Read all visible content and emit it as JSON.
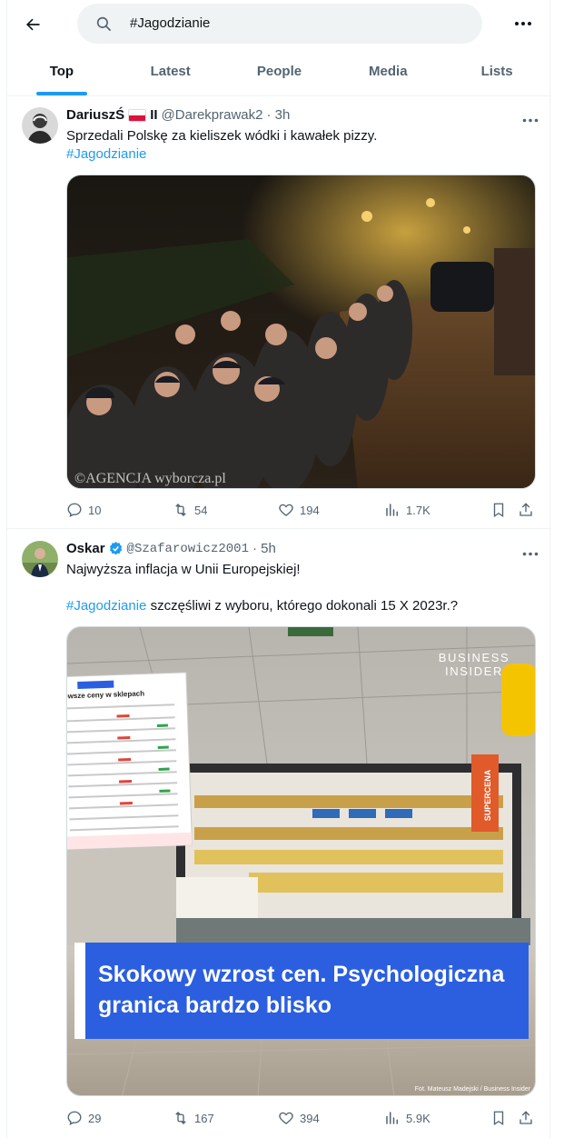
{
  "search": {
    "query": "#Jagodzianie"
  },
  "tabs": [
    {
      "label": "Top"
    },
    {
      "label": "Latest"
    },
    {
      "label": "People"
    },
    {
      "label": "Media"
    },
    {
      "label": "Lists"
    }
  ],
  "tweets": [
    {
      "name": "DariuszŚ",
      "name_suffix": "II",
      "handle": "@Darekprawak2",
      "time": "· 3h",
      "text": "Sprzedali Polskę za kieliszek wódki i kawałek pizzy.",
      "hashtag": "#Jagodzianie",
      "image_watermark": "©AGENCJA wyborcza.pl",
      "stats": {
        "replies": "10",
        "retweets": "54",
        "likes": "194",
        "views": "1.7K"
      }
    },
    {
      "name": "Oskar",
      "handle": "@Szafarowicz2001",
      "time": "· 5h",
      "text_line1": "Najwyższa inflacja w Unii Europejskiej!",
      "hashtag": "#Jagodzianie",
      "text_line2": " szczęśliwi z wyboru, którego dokonali 15 X 2023r.?",
      "image_brand_line1": "BUSINESS",
      "image_brand_line2": "INSIDER",
      "image_headline_line1": "Skokowy wzrost cen. Psychologiczna",
      "image_headline_line2": "granica bardzo blisko",
      "image_paper_title": "owsze ceny w sklepach",
      "image_shelf_sign": "SUPERCENA",
      "image_credit": "Fot. Mateusz Madejski / Business Insider",
      "stats": {
        "replies": "29",
        "retweets": "167",
        "likes": "394",
        "views": "5.9K"
      }
    }
  ],
  "colors": {
    "accent": "#1d9bf0",
    "secondary_text": "#536471",
    "headline_blue": "#2b5fe0"
  }
}
